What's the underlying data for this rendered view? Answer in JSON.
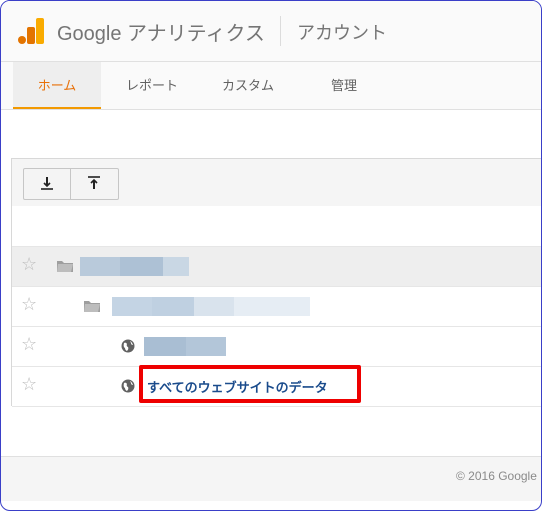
{
  "header": {
    "brand": "Google アナリティクス",
    "account_label": "アカウント"
  },
  "tabs": [
    {
      "label": "ホーム",
      "active": true
    },
    {
      "label": "レポート",
      "active": false
    },
    {
      "label": "カスタム",
      "active": false
    },
    {
      "label": "管理",
      "active": false
    }
  ],
  "toolbar": {
    "icons": [
      "download-icon",
      "upload-icon"
    ]
  },
  "rows": [
    {
      "type": "account",
      "icon": "folder-icon",
      "label": ""
    },
    {
      "type": "property",
      "icon": "folder-icon",
      "label": ""
    },
    {
      "type": "view",
      "icon": "globe-icon",
      "label": ""
    },
    {
      "type": "view",
      "icon": "globe-icon",
      "label": "すべてのウェブサイトのデータ"
    }
  ],
  "footer": {
    "copyright": "© 2016 Google"
  },
  "colors": {
    "accent": "#f29900",
    "active_tab_text": "#e8710a",
    "link": "#1a4b8c",
    "highlight_box": "#ee0000"
  }
}
